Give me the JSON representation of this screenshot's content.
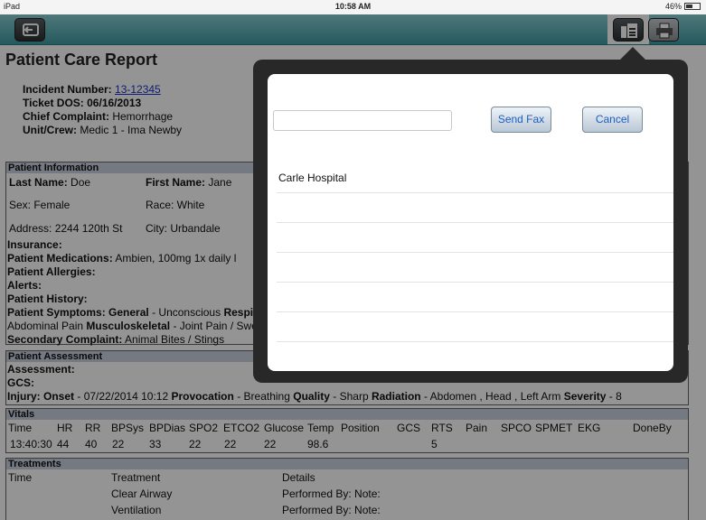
{
  "status_bar": {
    "device": "iPad",
    "time": "10:58 AM",
    "battery": "46%"
  },
  "toolbar": {
    "back_icon": "back-icon",
    "fax_icon": "fax-icon",
    "print_icon": "print-icon"
  },
  "report": {
    "title": "Patient Care Report",
    "incident_label": "Incident Number:",
    "incident_value": "13-12345",
    "ticket": "Ticket DOS: 06/16/2013",
    "complaint_label": "Chief Complaint:",
    "complaint_value": "Hemorrhage",
    "unit_label": "Unit/Crew:",
    "unit_value": "Medic 1 - Ima Newby"
  },
  "patient_info": {
    "header": "Patient Information",
    "last_name_label": "Last Name:",
    "last_name": "Doe",
    "first_name_label": "First Name:",
    "first_name": "Jane",
    "sex": "Sex: Female",
    "race": "Race: White",
    "address": "Address: 2244 120th St",
    "city": "City: Urbandale",
    "insurance": "Insurance:",
    "medications_label": "Patient Medications:",
    "medications": "Ambien, 100mg 1x daily l",
    "allergies": "Patient Allergies:",
    "alerts": "Alerts:",
    "history": "Patient History:",
    "symptoms_label": "Patient Symptoms:",
    "symptoms_general": "General",
    "symptoms_general_value": "- Unconscious",
    "symptoms_resp": "Respi",
    "symptoms_line2_a": "Abdominal Pain",
    "symptoms_line2_b": "Musculoskeletal",
    "symptoms_line2_c": "- Joint Pain / Swe",
    "secondary_label": "Secondary Complaint:",
    "secondary": "Animal Bites / Stings"
  },
  "assessment": {
    "header": "Patient Assessment",
    "assessment": "Assessment:",
    "gcs": "GCS:",
    "injury_label": "Injury:",
    "onset_label": "Onset",
    "onset": "- 07/22/2014 10:12",
    "provocation_label": "Provocation",
    "provocation": "- Breathing",
    "quality_label": "Quality",
    "quality": "- Sharp",
    "radiation_label": "Radiation",
    "radiation": "- Abdomen , Head , Left Arm",
    "severity_label": "Severity",
    "severity": "- 8"
  },
  "vitals": {
    "header": "Vitals",
    "columns": [
      "Time",
      "HR",
      "RR",
      "BPSys",
      "BPDias",
      "SPO2",
      "ETCO2",
      "Glucose",
      "Temp",
      "Position",
      "GCS",
      "RTS",
      "Pain",
      "SPCO",
      "SPMET",
      "EKG",
      "DoneBy"
    ],
    "row": [
      "13:40:30",
      "44",
      "40",
      "22",
      "33",
      "22",
      "22",
      "22",
      "98.6",
      "",
      "",
      "5",
      "",
      "",
      "",
      "",
      ""
    ]
  },
  "treatments": {
    "header": "Treatments",
    "col_time": "Time",
    "col_treatment": "Treatment",
    "col_details": "Details",
    "rows": [
      {
        "treatment": "Clear Airway",
        "details": "Performed By: Note:"
      },
      {
        "treatment": "Ventilation",
        "details": "Performed By: Note:"
      }
    ]
  },
  "fax_popover": {
    "input_value": "",
    "input_placeholder": "",
    "send_label": "Send Fax",
    "cancel_label": "Cancel",
    "recipients": [
      "Carle Hospital",
      "",
      "",
      "",
      "",
      "",
      ""
    ]
  },
  "colors": {
    "toolbar": "#4fa6ad",
    "popover": "#282828",
    "section_header": "#c8d0e0",
    "link": "#1a33c8",
    "button_text": "#1d5fbf"
  }
}
